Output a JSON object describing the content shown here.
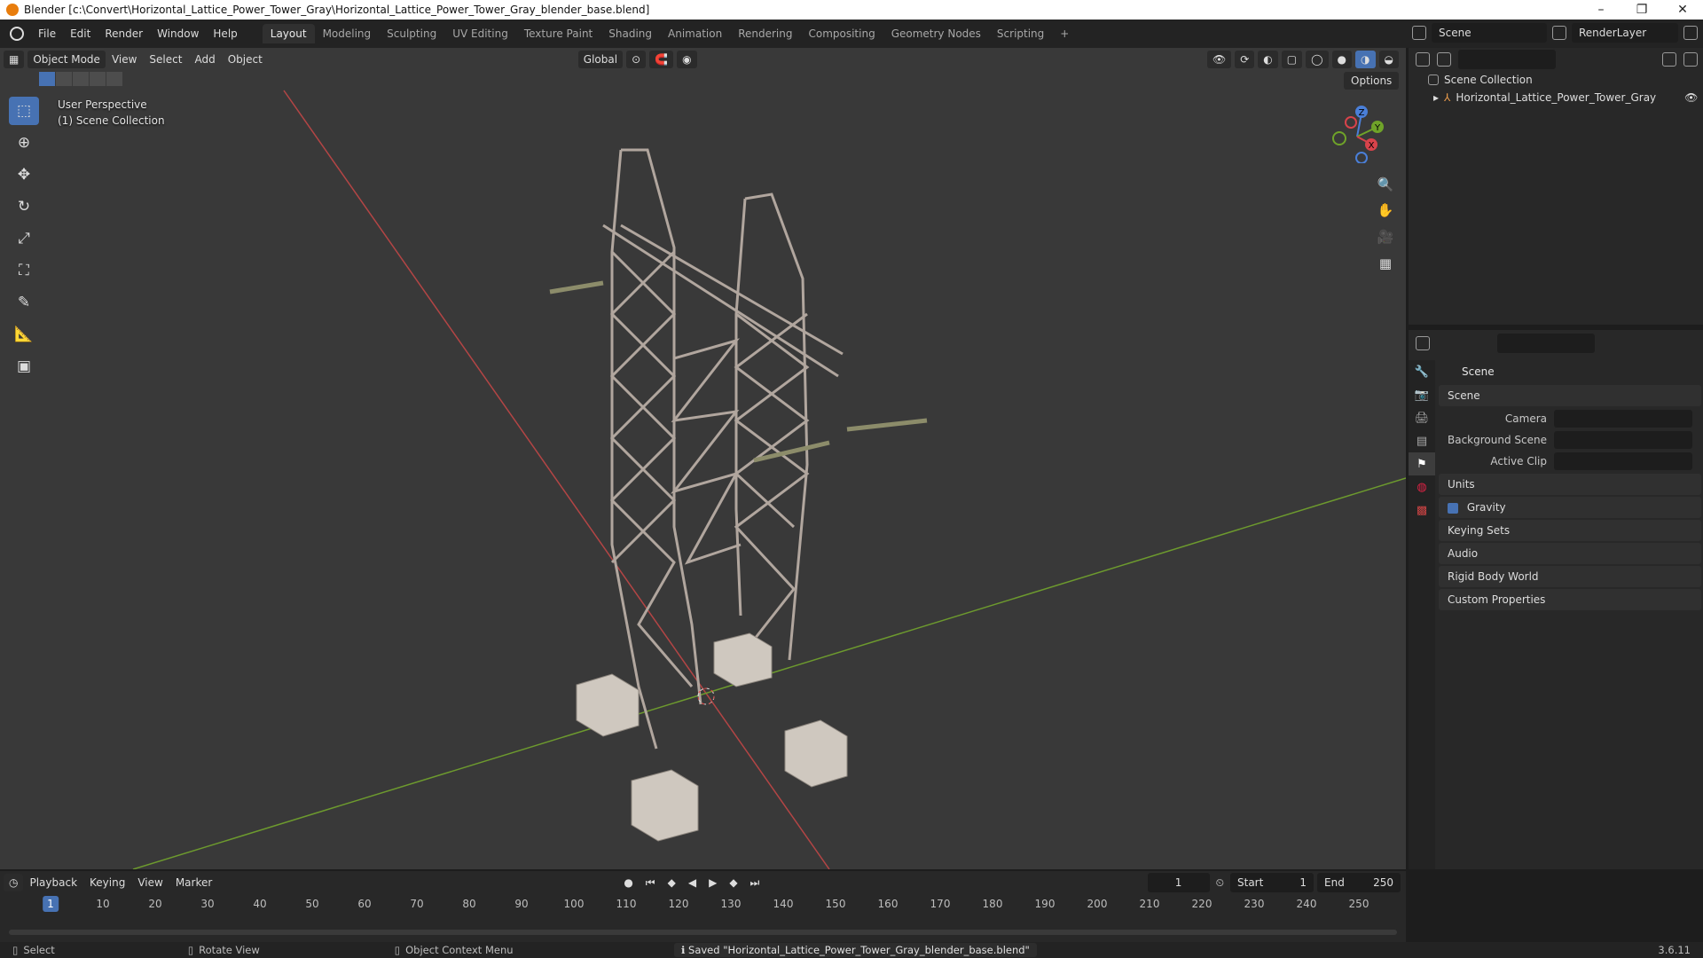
{
  "window": {
    "title": "Blender [c:\\Convert\\Horizontal_Lattice_Power_Tower_Gray\\Horizontal_Lattice_Power_Tower_Gray_blender_base.blend]",
    "minimize": "–",
    "maximize": "❐",
    "close": "✕"
  },
  "menus": [
    "File",
    "Edit",
    "Render",
    "Window",
    "Help"
  ],
  "workspaces": [
    "Layout",
    "Modeling",
    "Sculpting",
    "UV Editing",
    "Texture Paint",
    "Shading",
    "Animation",
    "Rendering",
    "Compositing",
    "Geometry Nodes",
    "Scripting"
  ],
  "workspace_add": "+",
  "scene_field": "Scene",
  "renderlayer_field": "RenderLayer",
  "viewport": {
    "mode": "Object Mode",
    "menus": [
      "View",
      "Select",
      "Add",
      "Object"
    ],
    "transform_orientation": "Global",
    "options": "Options",
    "perspective_label": "User Perspective",
    "collection_label": "(1) Scene Collection",
    "gizmo_axes": {
      "x": "X",
      "y": "Y",
      "z": "Z"
    }
  },
  "outliner": {
    "root": "Scene Collection",
    "object": "Horizontal_Lattice_Power_Tower_Gray"
  },
  "properties": {
    "title": "Scene",
    "panels": {
      "scene": "Scene",
      "camera": "Camera",
      "background_scene": "Background Scene",
      "active_clip": "Active Clip",
      "units": "Units",
      "gravity": "Gravity",
      "keying_sets": "Keying Sets",
      "audio": "Audio",
      "rigid_body_world": "Rigid Body World",
      "custom_properties": "Custom Properties"
    }
  },
  "timeline": {
    "menus": [
      "Playback",
      "Keying",
      "View",
      "Marker"
    ],
    "current_frame": "1",
    "start_label": "Start",
    "start": "1",
    "end_label": "End",
    "end": "250",
    "ticks": [
      "10",
      "20",
      "30",
      "40",
      "50",
      "60",
      "70",
      "80",
      "90",
      "100",
      "110",
      "120",
      "130",
      "140",
      "150",
      "160",
      "170",
      "180",
      "190",
      "200",
      "210",
      "220",
      "230",
      "240",
      "250"
    ]
  },
  "status": {
    "select": "Select",
    "rotate": "Rotate View",
    "context": "Object Context Menu",
    "message": "Saved \"Horizontal_Lattice_Power_Tower_Gray_blender_base.blend\"",
    "version": "3.6.11"
  }
}
